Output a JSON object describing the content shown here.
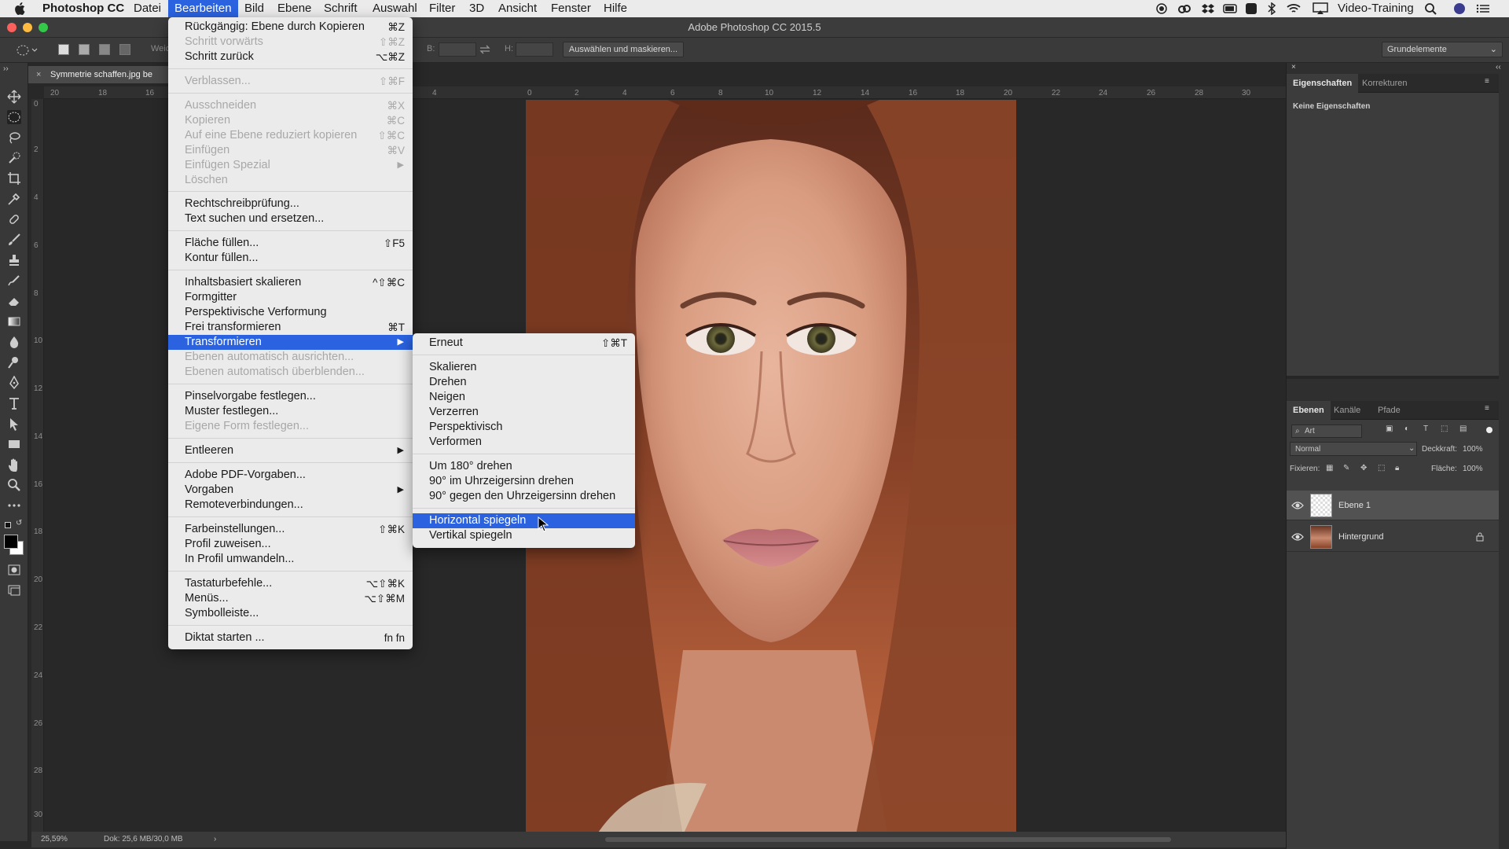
{
  "macbar": {
    "app_name": "Photoshop CC",
    "menus": [
      "Datei",
      "Bearbeiten",
      "Bild",
      "Ebene",
      "Schrift",
      "Auswahl",
      "Filter",
      "3D",
      "Ansicht",
      "Fenster",
      "Hilfe"
    ],
    "right_label": "Video-Training"
  },
  "window": {
    "title": "Adobe Photoshop CC 2015.5"
  },
  "options": {
    "weich_label": "Weic",
    "b_label": "B:",
    "h_label": "H:",
    "select_mask_button": "Auswählen und maskieren...",
    "workspace": "Grundelemente"
  },
  "document": {
    "tab_title": "Symmetrie schaffen.jpg be",
    "ruler_top_labels": [
      "20",
      "18",
      "16",
      "4",
      "0",
      "2",
      "4",
      "6",
      "8",
      "10",
      "12",
      "14",
      "16",
      "18",
      "20",
      "22",
      "24",
      "26",
      "28",
      "30"
    ],
    "ruler_left_labels": [
      "0",
      "2",
      "4",
      "6",
      "8",
      "10",
      "12",
      "14",
      "16",
      "18",
      "20",
      "22",
      "24",
      "26",
      "28",
      "30"
    ]
  },
  "status": {
    "zoom": "25,59%",
    "doc_size": "Dok: 25,6 MB/30,0 MB"
  },
  "edit_menu": {
    "items": [
      {
        "label": "Rückgängig: Ebene durch Kopieren",
        "shortcut": "⌘Z",
        "disabled": false
      },
      {
        "label": "Schritt vorwärts",
        "shortcut": "⇧⌘Z",
        "disabled": true
      },
      {
        "label": "Schritt zurück",
        "shortcut": "⌥⌘Z",
        "disabled": false
      },
      {
        "label": "Verblassen...",
        "shortcut": "⇧⌘F",
        "disabled": true
      },
      {
        "label": "Ausschneiden",
        "shortcut": "⌘X",
        "disabled": true
      },
      {
        "label": "Kopieren",
        "shortcut": "⌘C",
        "disabled": true
      },
      {
        "label": "Auf eine Ebene reduziert kopieren",
        "shortcut": "⇧⌘C",
        "disabled": true
      },
      {
        "label": "Einfügen",
        "shortcut": "⌘V",
        "disabled": true
      },
      {
        "label": "Einfügen Spezial",
        "shortcut": "▶",
        "disabled": true
      },
      {
        "label": "Löschen",
        "shortcut": "",
        "disabled": true
      },
      {
        "label": "Rechtschreibprüfung...",
        "shortcut": "",
        "disabled": false
      },
      {
        "label": "Text suchen und ersetzen...",
        "shortcut": "",
        "disabled": false
      },
      {
        "label": "Fläche füllen...",
        "shortcut": "⇧F5",
        "disabled": false
      },
      {
        "label": "Kontur füllen...",
        "shortcut": "",
        "disabled": false
      },
      {
        "label": "Inhaltsbasiert skalieren",
        "shortcut": "^⇧⌘C",
        "disabled": false
      },
      {
        "label": "Formgitter",
        "shortcut": "",
        "disabled": false
      },
      {
        "label": "Perspektivische Verformung",
        "shortcut": "",
        "disabled": false
      },
      {
        "label": "Frei transformieren",
        "shortcut": "⌘T",
        "disabled": false
      },
      {
        "label": "Transformieren",
        "shortcut": "▶",
        "disabled": false
      },
      {
        "label": "Ebenen automatisch ausrichten...",
        "shortcut": "",
        "disabled": true
      },
      {
        "label": "Ebenen automatisch überblenden...",
        "shortcut": "",
        "disabled": true
      },
      {
        "label": "Pinselvorgabe festlegen...",
        "shortcut": "",
        "disabled": false
      },
      {
        "label": "Muster festlegen...",
        "shortcut": "",
        "disabled": false
      },
      {
        "label": "Eigene Form festlegen...",
        "shortcut": "",
        "disabled": true
      },
      {
        "label": "Entleeren",
        "shortcut": "▶",
        "disabled": false
      },
      {
        "label": "Adobe PDF-Vorgaben...",
        "shortcut": "",
        "disabled": false
      },
      {
        "label": "Vorgaben",
        "shortcut": "▶",
        "disabled": false
      },
      {
        "label": "Remoteverbindungen...",
        "shortcut": "",
        "disabled": false
      },
      {
        "label": "Farbeinstellungen...",
        "shortcut": "⇧⌘K",
        "disabled": false
      },
      {
        "label": "Profil zuweisen...",
        "shortcut": "",
        "disabled": false
      },
      {
        "label": "In Profil umwandeln...",
        "shortcut": "",
        "disabled": false
      },
      {
        "label": "Tastaturbefehle...",
        "shortcut": "⌥⇧⌘K",
        "disabled": false
      },
      {
        "label": "Menüs...",
        "shortcut": "⌥⇧⌘M",
        "disabled": false
      },
      {
        "label": "Symbolleiste...",
        "shortcut": "",
        "disabled": false
      },
      {
        "label": "Diktat starten ...",
        "shortcut": "fn fn",
        "disabled": false
      }
    ]
  },
  "transform_menu": {
    "items": [
      {
        "label": "Erneut",
        "shortcut": "⇧⌘T"
      },
      {
        "label": "Skalieren",
        "shortcut": ""
      },
      {
        "label": "Drehen",
        "shortcut": ""
      },
      {
        "label": "Neigen",
        "shortcut": ""
      },
      {
        "label": "Verzerren",
        "shortcut": ""
      },
      {
        "label": "Perspektivisch",
        "shortcut": ""
      },
      {
        "label": "Verformen",
        "shortcut": ""
      },
      {
        "label": "Um 180° drehen",
        "shortcut": ""
      },
      {
        "label": "90° im Uhrzeigersinn drehen",
        "shortcut": ""
      },
      {
        "label": "90° gegen den Uhrzeigersinn drehen",
        "shortcut": ""
      },
      {
        "label": "Horizontal spiegeln",
        "shortcut": ""
      },
      {
        "label": "Vertikal spiegeln",
        "shortcut": ""
      }
    ]
  },
  "properties_panel": {
    "tabs": [
      "Eigenschaften",
      "Korrekturen"
    ],
    "empty_text": "Keine Eigenschaften"
  },
  "layers_panel": {
    "tabs": [
      "Ebenen",
      "Kanäle",
      "Pfade"
    ],
    "filter": "Art",
    "blend_mode": "Normal",
    "opacity_label": "Deckkraft:",
    "opacity_value": "100%",
    "lock_label": "Fixieren:",
    "fill_label": "Fläche:",
    "fill_value": "100%",
    "layers": [
      {
        "name": "Ebene 1",
        "selected": true
      },
      {
        "name": "Hintergrund",
        "selected": false
      }
    ]
  },
  "colors": {
    "menu_highlight": "#2a62e0",
    "panel_bg": "#3c3c3c",
    "app_bg": "#282828"
  }
}
